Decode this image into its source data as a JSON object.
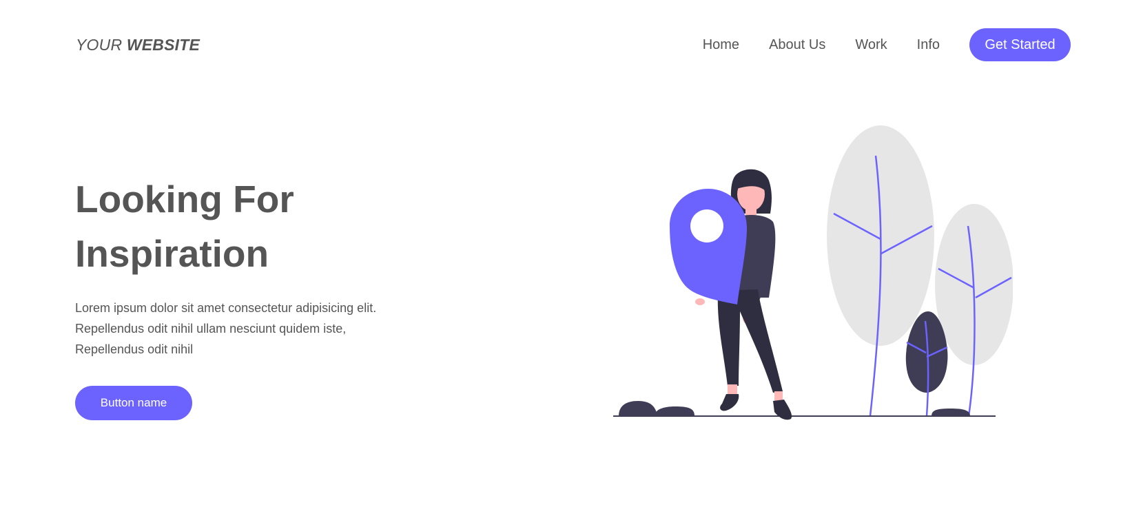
{
  "header": {
    "logo_light": "YOUR ",
    "logo_bold": "WEBSITE",
    "nav": [
      {
        "label": "Home"
      },
      {
        "label": "About Us"
      },
      {
        "label": "Work"
      },
      {
        "label": "Info"
      }
    ],
    "cta_label": "Get Started"
  },
  "hero": {
    "title_line1": "Looking For",
    "title_line2": "Inspiration",
    "desc_lines": [
      "Lorem ipsum dolor sit amet consectetur adipisicing elit.",
      "Repellendus odit nihil ullam nesciunt quidem iste,",
      "Repellendus odit nihil"
    ],
    "button_label": "Button name"
  },
  "colors": {
    "accent": "#6c63ff",
    "text": "#555555",
    "tree_leaf": "#e6e6e6",
    "dark": "#3f3d56",
    "skin": "#ffb8b8"
  },
  "illustration": {
    "icon": "woman-holding-map-pin-illustration"
  }
}
